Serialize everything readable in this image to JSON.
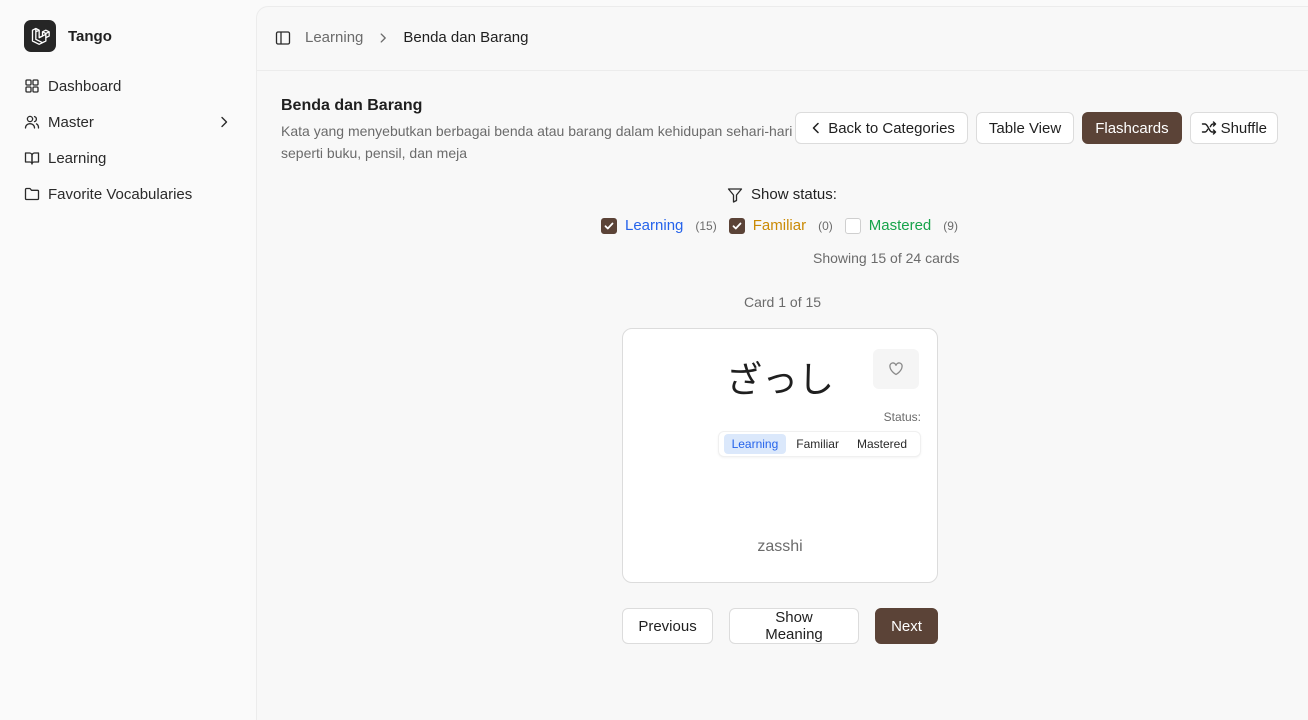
{
  "app": {
    "name": "Tango"
  },
  "sidebar": {
    "items": [
      {
        "label": "Dashboard",
        "icon": "grid-icon"
      },
      {
        "label": "Master",
        "icon": "users-icon"
      },
      {
        "label": "Learning",
        "icon": "book-icon"
      },
      {
        "label": "Favorite Vocabularies",
        "icon": "folder-icon"
      }
    ]
  },
  "breadcrumb": {
    "parent": "Learning",
    "current": "Benda dan Barang"
  },
  "page": {
    "title": "Benda dan Barang",
    "description": "Kata yang menyebutkan berbagai benda atau barang dalam kehidupan sehari-hari seperti buku, pensil, dan meja"
  },
  "actions": {
    "back": "Back to Categories",
    "table_view": "Table View",
    "flashcards": "Flashcards",
    "shuffle": "Shuffle"
  },
  "filters": {
    "title": "Show status:",
    "items": [
      {
        "label": "Learning",
        "count": "(15)",
        "checked": true,
        "color": "#2563eb"
      },
      {
        "label": "Familiar",
        "count": "(0)",
        "checked": true,
        "color": "#ca8a04"
      },
      {
        "label": "Mastered",
        "count": "(9)",
        "checked": false,
        "color": "#16a34a"
      }
    ],
    "showing": "Showing 15 of 24 cards"
  },
  "card": {
    "counter": "Card 1 of 15",
    "word": "ざっし",
    "romaji": "zasshi",
    "status_label": "Status:",
    "status_options": [
      "Learning",
      "Familiar",
      "Mastered"
    ],
    "status_selected": "Learning"
  },
  "navigation": {
    "previous": "Previous",
    "show_meaning": "Show Meaning",
    "next": "Next"
  },
  "colors": {
    "primary": "#5b4337",
    "learning": "#2563eb",
    "familiar": "#ca8a04",
    "mastered": "#16a34a"
  }
}
